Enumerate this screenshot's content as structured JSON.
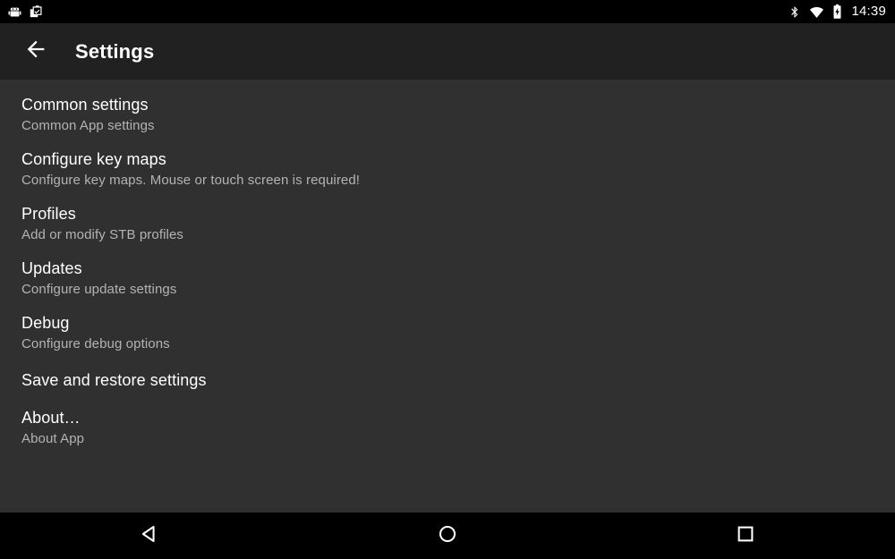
{
  "status_bar": {
    "left_icons": [
      {
        "name": "android-robot-icon",
        "label": "android"
      },
      {
        "name": "clipboard-check-icon",
        "label": "clipboard"
      }
    ],
    "right_icons": [
      {
        "name": "bluetooth-icon",
        "label": "bluetooth"
      },
      {
        "name": "wifi-icon",
        "label": "wifi"
      },
      {
        "name": "battery-charging-icon",
        "label": "battery charging"
      }
    ],
    "clock": "14:39"
  },
  "toolbar": {
    "back_icon": "arrow-back-icon",
    "title": "Settings"
  },
  "preferences": [
    {
      "title": "Common settings",
      "summary": "Common App settings"
    },
    {
      "title": "Configure key maps",
      "summary": "Configure key maps. Mouse or touch screen is required!"
    },
    {
      "title": "Profiles",
      "summary": "Add or modify STB profiles"
    },
    {
      "title": "Updates",
      "summary": "Configure update settings"
    },
    {
      "title": "Debug",
      "summary": "Configure debug options"
    },
    {
      "title": "Save and restore settings",
      "summary": ""
    },
    {
      "title": "About…",
      "summary": "About App"
    }
  ],
  "nav_bar": {
    "back": "back-nav-button",
    "home": "home-nav-button",
    "recents": "recents-nav-button"
  },
  "colors": {
    "status_bar_bg": "#000000",
    "toolbar_bg": "#212121",
    "content_bg": "#303030",
    "nav_bar_bg": "#000000",
    "title_text": "#ffffff",
    "summary_text": "#b3b3b3"
  }
}
